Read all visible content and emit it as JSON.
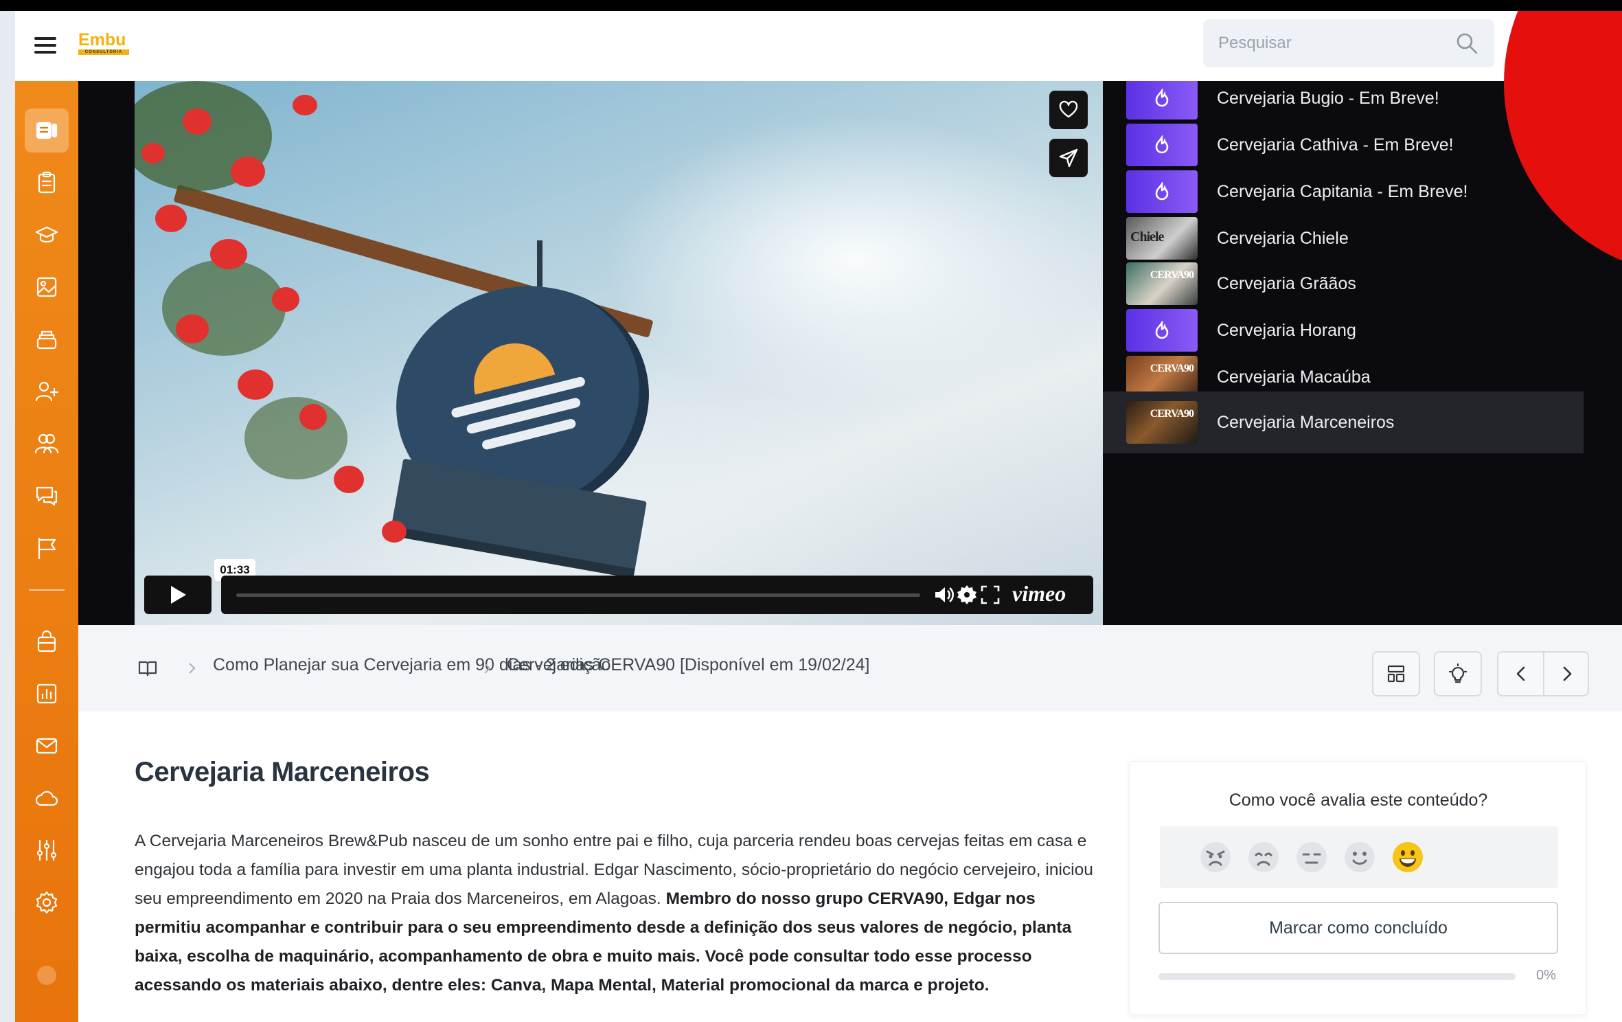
{
  "brand": {
    "logo_text": "Embu",
    "logo_sub": "CONSULTORIA",
    "accent": "#f08a1a",
    "sidebar_color": "#e8740b"
  },
  "topbar": {
    "search_placeholder": "Pesquisar",
    "search_icon": "search-icon",
    "bell_icon": "bell-icon",
    "avatar_icon": "user-avatar"
  },
  "sidebar": {
    "items": [
      {
        "icon": "video-lesson-icon",
        "active": true
      },
      {
        "icon": "clipboard-icon"
      },
      {
        "icon": "graduation-cap-icon"
      },
      {
        "icon": "image-icon"
      },
      {
        "icon": "stack-layers-icon"
      },
      {
        "icon": "user-add-icon"
      },
      {
        "icon": "users-icon"
      },
      {
        "icon": "chat-icon"
      },
      {
        "icon": "flag-icon"
      },
      {
        "icon": "shopping-bag-icon"
      },
      {
        "icon": "bar-chart-icon"
      },
      {
        "icon": "mail-icon"
      },
      {
        "icon": "cloud-icon"
      },
      {
        "icon": "sliders-icon"
      },
      {
        "icon": "gear-icon"
      }
    ]
  },
  "video": {
    "time": "01:33",
    "brand": "vimeo",
    "progress": 0.01
  },
  "playlist": [
    {
      "label": "Cervejaria Bugio - Em Breve!",
      "thumb": "purple"
    },
    {
      "label": "Cervejaria Cathiva - Em Breve!",
      "thumb": "purple"
    },
    {
      "label": "Cervejaria Capitania - Em Breve!",
      "thumb": "purple"
    },
    {
      "label": "Cervejaria Chiele",
      "thumb": "photo",
      "thumb_text": "Chiele"
    },
    {
      "label": "Cervejaria Grããos",
      "thumb": "photo",
      "thumb_text": "CERVA90"
    },
    {
      "label": "Cervejaria Horang",
      "thumb": "purple"
    },
    {
      "label": "Cervejaria Macaúba",
      "thumb": "photo",
      "thumb_text": "CERVA90"
    },
    {
      "label": "Cervejaria Marceneiros",
      "thumb": "photo",
      "thumb_text": "CERVA90",
      "active": true
    }
  ],
  "breadcrumb": {
    "items": [
      "Como Planejar sua Cervejaria em 90 dias - 2 edição",
      "Cervejarias CERVA90 [Disponível em 19/02/24]"
    ]
  },
  "content": {
    "title": "Cervejaria Marceneiros",
    "desc_plain": "A Cervejaria Marceneiros Brew&Pub nasceu de um sonho entre pai e filho, cuja parceria rendeu boas cervejas feitas em casa e engajou toda a família para investir em uma planta industrial. Edgar Nascimento, sócio-proprietário do negócio cervejeiro, iniciou seu empreendimento em 2020 na Praia dos Marceneiros, em Alagoas.",
    "desc_bold": "Membro do nosso grupo CERVA90, Edgar nos permitiu acompanhar e contribuir para o seu empreendimento desde a definição dos seus valores de negócio, planta baixa, escolha de maquinário, acompanhamento de obra e muito mais. Você pode consultar todo esse processo acessando os materiais abaixo, dentre eles: Canva, Mapa Mental, Material promocional da marca e projeto."
  },
  "rating": {
    "question": "Como você avalia este conteúdo?",
    "faces": [
      "angry-face-icon",
      "sad-face-icon",
      "neutral-face-icon",
      "smile-face-icon",
      "grin-face-icon"
    ],
    "selected": 4,
    "complete_label": "Marcar como concluído",
    "progress_text": "0%",
    "progress": 0
  }
}
